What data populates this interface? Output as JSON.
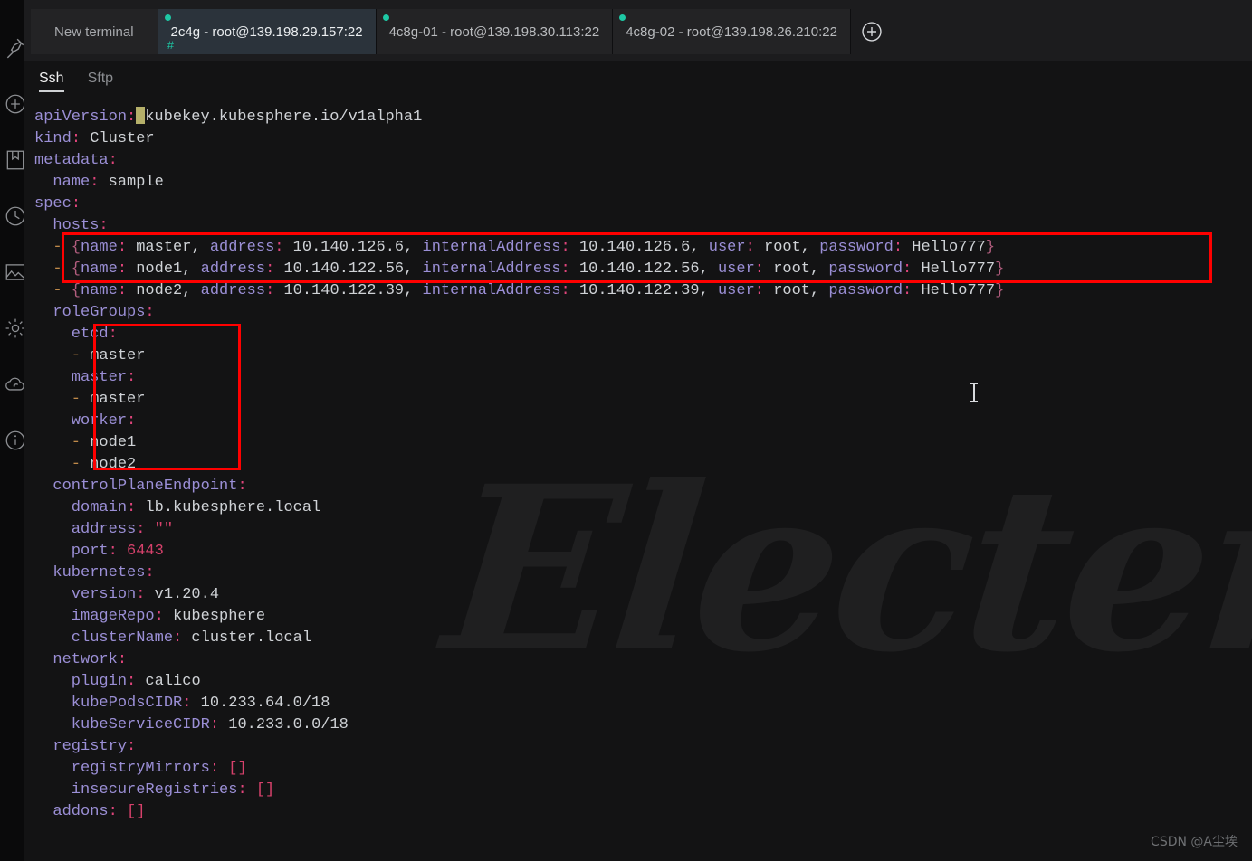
{
  "app": {
    "watermark": "Electerm",
    "footer_watermark": "CSDN @A尘埃"
  },
  "rail": {
    "items": [
      {
        "name": "pin-icon",
        "label": "Pin"
      },
      {
        "name": "plus-circle-icon",
        "label": "New"
      },
      {
        "name": "bookmark-icon",
        "label": "Bookmarks"
      },
      {
        "name": "history-clock-icon",
        "label": "History"
      },
      {
        "name": "image-icon",
        "label": "Background"
      },
      {
        "name": "gear-icon",
        "label": "Settings"
      },
      {
        "name": "cloud-sync-icon",
        "label": "Sync"
      },
      {
        "name": "info-icon",
        "label": "About"
      }
    ]
  },
  "tabbar": {
    "tabs": [
      {
        "label": "New terminal",
        "active": false,
        "status": "idle"
      },
      {
        "label": "2c4g - root@139.198.29.157:22",
        "active": true,
        "status": "connected",
        "badge": "#"
      },
      {
        "label": "4c8g-01 - root@139.198.30.113:22",
        "active": false,
        "status": "connected"
      },
      {
        "label": "4c8g-02 - root@139.198.26.210:22",
        "active": false,
        "status": "connected"
      }
    ],
    "add_tab_label": "+"
  },
  "subtabs": {
    "items": [
      {
        "label": "Ssh",
        "active": true
      },
      {
        "label": "Sftp",
        "active": false
      }
    ]
  },
  "colors": {
    "key": "#9b8fd6",
    "punctuation": "#e0457b",
    "value": "#cfd2d6",
    "number": "#d6416b",
    "dash": "#c08a4a",
    "annotation": "#ff0000",
    "accent_teal": "#1ec8a5",
    "cursor": "#b5b06a",
    "background": "#131314"
  },
  "terminal": {
    "lines": [
      [
        {
          "t": "apiVersion",
          "c": "k"
        },
        {
          "t": ":",
          "c": "c"
        },
        {
          "t": "CURSOR",
          "c": "cursor"
        },
        {
          "t": "kubekey.kubesphere.io/v1alpha1",
          "c": "v"
        }
      ],
      [
        {
          "t": "kind",
          "c": "k"
        },
        {
          "t": ":",
          "c": "c"
        },
        {
          "t": " Cluster",
          "c": "v"
        }
      ],
      [
        {
          "t": "metadata",
          "c": "k"
        },
        {
          "t": ":",
          "c": "c"
        }
      ],
      [
        {
          "t": "  name",
          "c": "k"
        },
        {
          "t": ":",
          "c": "c"
        },
        {
          "t": " sample",
          "c": "v"
        }
      ],
      [
        {
          "t": "spec",
          "c": "k"
        },
        {
          "t": ":",
          "c": "c"
        }
      ],
      [
        {
          "t": "  hosts",
          "c": "k"
        },
        {
          "t": ":",
          "c": "c"
        }
      ],
      [
        {
          "t": "  -",
          "c": "d"
        },
        {
          "t": " {",
          "c": "br"
        },
        {
          "t": "name",
          "c": "k"
        },
        {
          "t": ":",
          "c": "c"
        },
        {
          "t": " master, ",
          "c": "v"
        },
        {
          "t": "address",
          "c": "k"
        },
        {
          "t": ":",
          "c": "c"
        },
        {
          "t": " 10.140.126.6, ",
          "c": "v"
        },
        {
          "t": "internalAddress",
          "c": "k"
        },
        {
          "t": ":",
          "c": "c"
        },
        {
          "t": " 10.140.126.6, ",
          "c": "v"
        },
        {
          "t": "user",
          "c": "k"
        },
        {
          "t": ":",
          "c": "c"
        },
        {
          "t": " root, ",
          "c": "v"
        },
        {
          "t": "password",
          "c": "k"
        },
        {
          "t": ":",
          "c": "c"
        },
        {
          "t": " Hello777",
          "c": "v"
        },
        {
          "t": "}",
          "c": "br"
        }
      ],
      [
        {
          "t": "  -",
          "c": "d"
        },
        {
          "t": " {",
          "c": "br"
        },
        {
          "t": "name",
          "c": "k"
        },
        {
          "t": ":",
          "c": "c"
        },
        {
          "t": " node1, ",
          "c": "v"
        },
        {
          "t": "address",
          "c": "k"
        },
        {
          "t": ":",
          "c": "c"
        },
        {
          "t": " 10.140.122.56, ",
          "c": "v"
        },
        {
          "t": "internalAddress",
          "c": "k"
        },
        {
          "t": ":",
          "c": "c"
        },
        {
          "t": " 10.140.122.56, ",
          "c": "v"
        },
        {
          "t": "user",
          "c": "k"
        },
        {
          "t": ":",
          "c": "c"
        },
        {
          "t": " root, ",
          "c": "v"
        },
        {
          "t": "password",
          "c": "k"
        },
        {
          "t": ":",
          "c": "c"
        },
        {
          "t": " Hello777",
          "c": "v"
        },
        {
          "t": "}",
          "c": "br"
        }
      ],
      [
        {
          "t": "  -",
          "c": "d"
        },
        {
          "t": " {",
          "c": "br"
        },
        {
          "t": "name",
          "c": "k"
        },
        {
          "t": ":",
          "c": "c"
        },
        {
          "t": " node2, ",
          "c": "v"
        },
        {
          "t": "address",
          "c": "k"
        },
        {
          "t": ":",
          "c": "c"
        },
        {
          "t": " 10.140.122.39, ",
          "c": "v"
        },
        {
          "t": "internalAddress",
          "c": "k"
        },
        {
          "t": ":",
          "c": "c"
        },
        {
          "t": " 10.140.122.39, ",
          "c": "v"
        },
        {
          "t": "user",
          "c": "k"
        },
        {
          "t": ":",
          "c": "c"
        },
        {
          "t": " root, ",
          "c": "v"
        },
        {
          "t": "password",
          "c": "k"
        },
        {
          "t": ":",
          "c": "c"
        },
        {
          "t": " Hello777",
          "c": "v"
        },
        {
          "t": "}",
          "c": "br"
        }
      ],
      [
        {
          "t": "  roleGroups",
          "c": "k"
        },
        {
          "t": ":",
          "c": "c"
        }
      ],
      [
        {
          "t": "    etcd",
          "c": "k"
        },
        {
          "t": ":",
          "c": "c"
        }
      ],
      [
        {
          "t": "    -",
          "c": "d"
        },
        {
          "t": " master",
          "c": "v"
        }
      ],
      [
        {
          "t": "    master",
          "c": "k"
        },
        {
          "t": ":",
          "c": "c"
        }
      ],
      [
        {
          "t": "    -",
          "c": "d"
        },
        {
          "t": " master",
          "c": "v"
        }
      ],
      [
        {
          "t": "    worker",
          "c": "k"
        },
        {
          "t": ":",
          "c": "c"
        }
      ],
      [
        {
          "t": "    -",
          "c": "d"
        },
        {
          "t": " node1",
          "c": "v"
        }
      ],
      [
        {
          "t": "    -",
          "c": "d"
        },
        {
          "t": " node2",
          "c": "v"
        }
      ],
      [
        {
          "t": "  controlPlaneEndpoint",
          "c": "k"
        },
        {
          "t": ":",
          "c": "c"
        }
      ],
      [
        {
          "t": "    domain",
          "c": "k"
        },
        {
          "t": ":",
          "c": "c"
        },
        {
          "t": " lb.kubesphere.local",
          "c": "v"
        }
      ],
      [
        {
          "t": "    address",
          "c": "k"
        },
        {
          "t": ":",
          "c": "c"
        },
        {
          "t": " ",
          "c": "v"
        },
        {
          "t": "\"\"",
          "c": "b"
        }
      ],
      [
        {
          "t": "    port",
          "c": "k"
        },
        {
          "t": ":",
          "c": "c"
        },
        {
          "t": " ",
          "c": "v"
        },
        {
          "t": "6443",
          "c": "n"
        }
      ],
      [
        {
          "t": "  kubernetes",
          "c": "k"
        },
        {
          "t": ":",
          "c": "c"
        }
      ],
      [
        {
          "t": "    version",
          "c": "k"
        },
        {
          "t": ":",
          "c": "c"
        },
        {
          "t": " v1.20.4",
          "c": "v"
        }
      ],
      [
        {
          "t": "    imageRepo",
          "c": "k"
        },
        {
          "t": ":",
          "c": "c"
        },
        {
          "t": " kubesphere",
          "c": "v"
        }
      ],
      [
        {
          "t": "    clusterName",
          "c": "k"
        },
        {
          "t": ":",
          "c": "c"
        },
        {
          "t": " cluster.local",
          "c": "v"
        }
      ],
      [
        {
          "t": "  network",
          "c": "k"
        },
        {
          "t": ":",
          "c": "c"
        }
      ],
      [
        {
          "t": "    plugin",
          "c": "k"
        },
        {
          "t": ":",
          "c": "c"
        },
        {
          "t": " calico",
          "c": "v"
        }
      ],
      [
        {
          "t": "    kubePodsCIDR",
          "c": "k"
        },
        {
          "t": ":",
          "c": "c"
        },
        {
          "t": " 10.233.64.0/18",
          "c": "v"
        }
      ],
      [
        {
          "t": "    kubeServiceCIDR",
          "c": "k"
        },
        {
          "t": ":",
          "c": "c"
        },
        {
          "t": " 10.233.0.0/18",
          "c": "v"
        }
      ],
      [
        {
          "t": "  registry",
          "c": "k"
        },
        {
          "t": ":",
          "c": "c"
        }
      ],
      [
        {
          "t": "    registryMirrors",
          "c": "k"
        },
        {
          "t": ":",
          "c": "c"
        },
        {
          "t": " ",
          "c": "v"
        },
        {
          "t": "[]",
          "c": "b"
        }
      ],
      [
        {
          "t": "    insecureRegistries",
          "c": "k"
        },
        {
          "t": ":",
          "c": "c"
        },
        {
          "t": " ",
          "c": "v"
        },
        {
          "t": "[]",
          "c": "b"
        }
      ],
      [
        {
          "t": "  addons",
          "c": "k"
        },
        {
          "t": ":",
          "c": "c"
        },
        {
          "t": " ",
          "c": "v"
        },
        {
          "t": "[]",
          "c": "b"
        }
      ]
    ]
  },
  "annotations": [
    {
      "name": "hosts-highlight",
      "target": "spec.hosts entries"
    },
    {
      "name": "rolegroups-highlight",
      "target": "spec.roleGroups entries"
    }
  ]
}
